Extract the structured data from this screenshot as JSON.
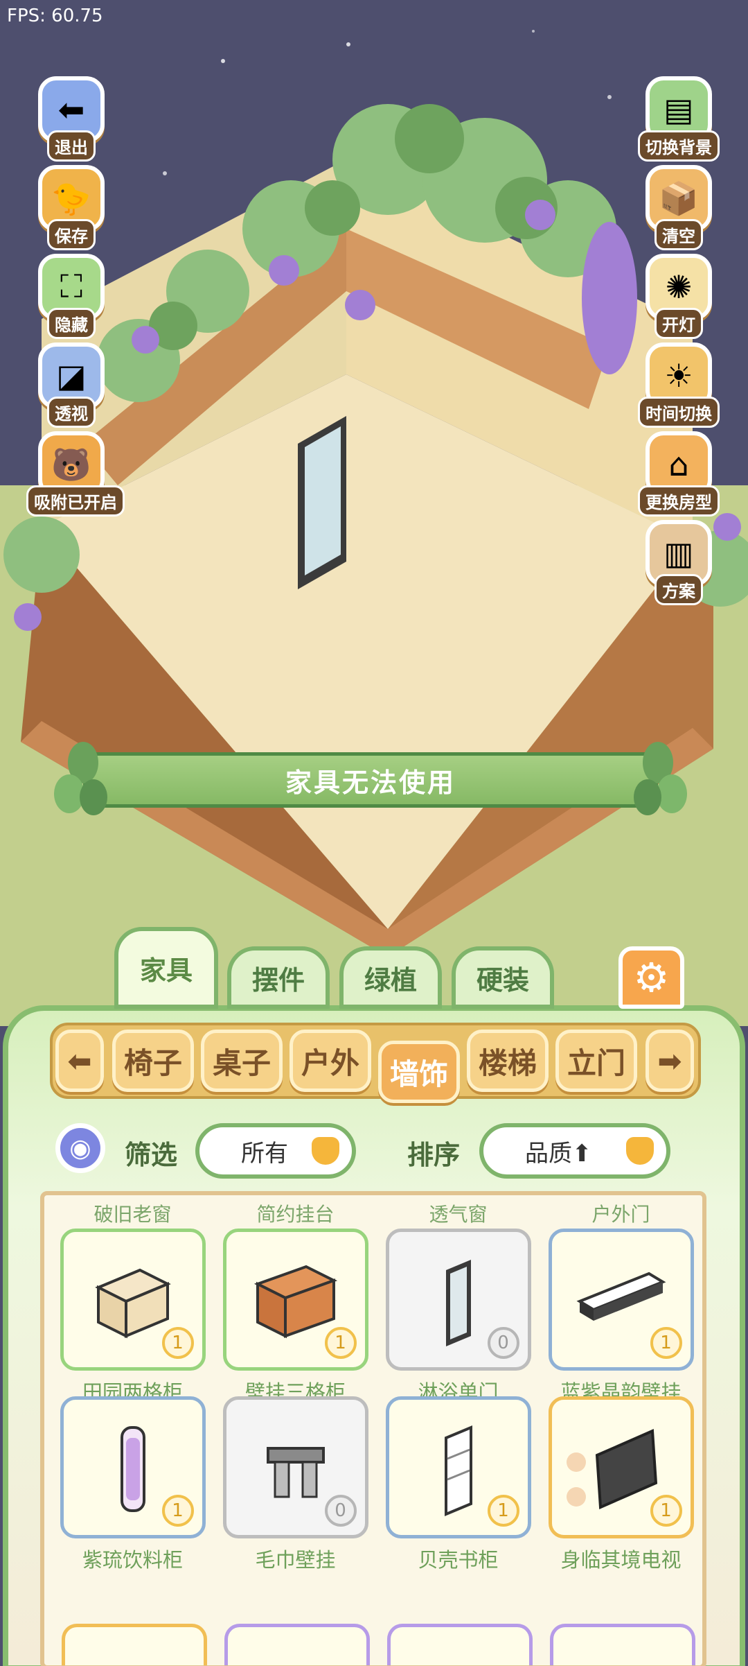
{
  "fps": "FPS: 60.75",
  "left_buttons": [
    {
      "label": "退出",
      "icon": "exit-arrow-icon"
    },
    {
      "label": "保存",
      "icon": "save-bird-icon"
    },
    {
      "label": "隐藏",
      "icon": "hide-icon"
    },
    {
      "label": "透视",
      "icon": "perspective-cube-icon"
    },
    {
      "label": "吸附已开启",
      "icon": "snap-icon"
    }
  ],
  "right_buttons": [
    {
      "label": "切换背景",
      "icon": "background-icon"
    },
    {
      "label": "清空",
      "icon": "clear-box-icon"
    },
    {
      "label": "开灯",
      "icon": "light-icon"
    },
    {
      "label": "时间切换",
      "icon": "sun-moon-icon"
    },
    {
      "label": "更换房型",
      "icon": "house-icon"
    },
    {
      "label": "方案",
      "icon": "plan-icon"
    }
  ],
  "banner_text": "家具无法使用",
  "tabs": [
    {
      "label": "家具",
      "active": true
    },
    {
      "label": "摆件",
      "active": false
    },
    {
      "label": "绿植",
      "active": false
    },
    {
      "label": "硬装",
      "active": false
    }
  ],
  "categories": [
    {
      "label": "椅子",
      "active": false
    },
    {
      "label": "桌子",
      "active": false
    },
    {
      "label": "户外",
      "active": false
    },
    {
      "label": "墙饰",
      "active": true
    },
    {
      "label": "楼梯",
      "active": false
    },
    {
      "label": "立门",
      "active": false
    }
  ],
  "filter": {
    "label": "筛选",
    "value": "所有"
  },
  "sort": {
    "label": "排序",
    "value": "品质⬆"
  },
  "items": [
    {
      "top_label": "破旧老窗",
      "name": "田园两格柜",
      "qty": "1",
      "frame": "green"
    },
    {
      "top_label": "简约挂台",
      "name": "壁挂三格柜",
      "qty": "1",
      "frame": "green"
    },
    {
      "top_label": "透气窗",
      "name": "淋浴单门",
      "qty": "0",
      "frame": "grey"
    },
    {
      "top_label": "户外门",
      "name": "蓝紫晶韵壁挂",
      "qty": "1",
      "frame": "blue"
    },
    {
      "top_label": "",
      "name": "紫琉饮料柜",
      "qty": "1",
      "frame": "blue"
    },
    {
      "top_label": "",
      "name": "毛巾壁挂",
      "qty": "0",
      "frame": "grey"
    },
    {
      "top_label": "",
      "name": "贝壳书柜",
      "qty": "1",
      "frame": "blue"
    },
    {
      "top_label": "",
      "name": "身临其境电视",
      "qty": "1",
      "frame": "gold"
    }
  ]
}
